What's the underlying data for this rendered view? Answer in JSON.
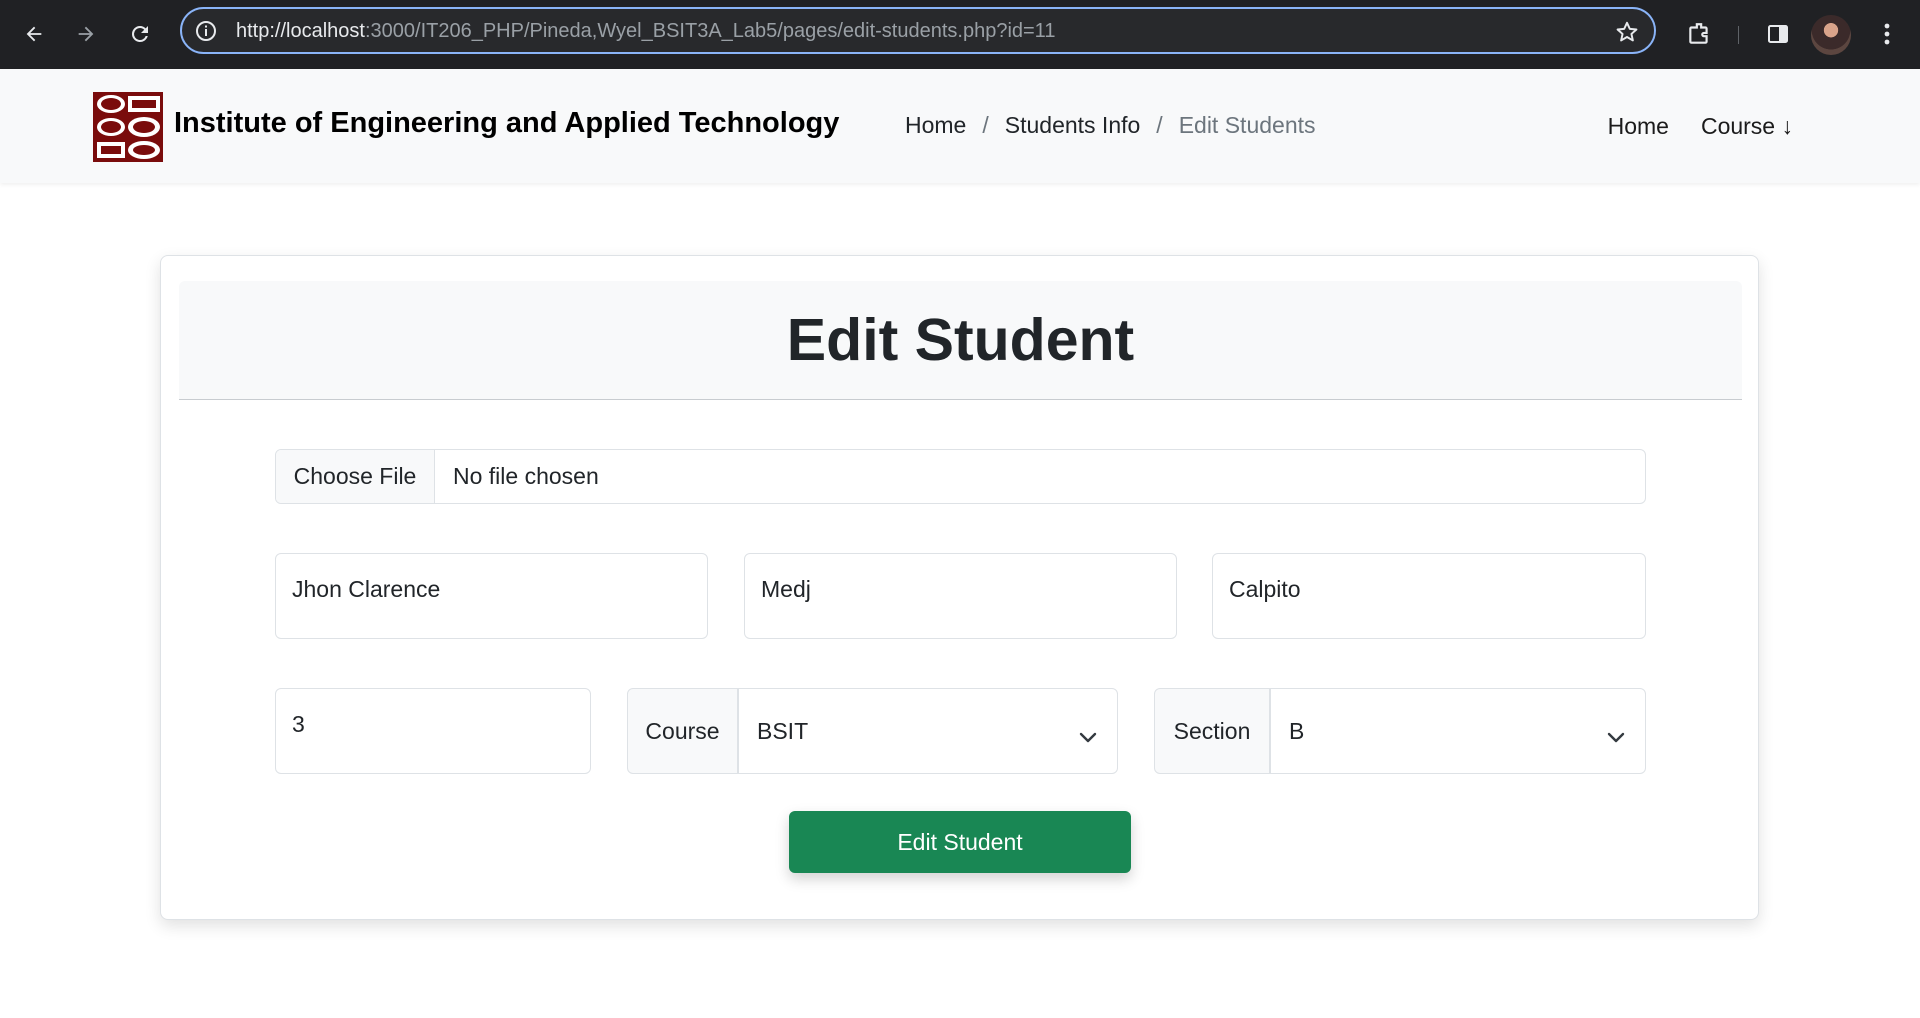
{
  "browser": {
    "url_host": "http://localhost",
    "url_path": ":3000/IT206_PHP/Pineda,Wyel_BSIT3A_Lab5/pages/edit-students.php?id=11",
    "icons": [
      "back-arrow-icon",
      "forward-arrow-icon",
      "reload-icon",
      "site-info-icon",
      "bookmark-star-icon",
      "extensions-icon",
      "side-panel-icon",
      "profile-avatar",
      "more-menu-icon"
    ]
  },
  "navbar": {
    "brand": "Institute of Engineering and Applied Technology",
    "breadcrumb": [
      {
        "label": "Home"
      },
      {
        "label": "Students Info"
      },
      {
        "label": "Edit Students"
      }
    ],
    "separator": "/",
    "links": [
      {
        "label": "Home"
      },
      {
        "label": "Course ↓"
      }
    ]
  },
  "form": {
    "title": "Edit Student",
    "file_button": "Choose File",
    "file_status": "No file chosen",
    "first_name": "Jhon Clarence",
    "middle_name": "Medj",
    "last_name": "Calpito",
    "year": "3",
    "course_label": "Course",
    "course_value": "BSIT",
    "section_label": "Section",
    "section_value": "B",
    "submit_label": "Edit Student"
  },
  "colors": {
    "primary_button": "#198754",
    "logo": "#7a0c0c",
    "chrome_bg": "#202124",
    "omnibox_focus": "#8ab4f8"
  }
}
